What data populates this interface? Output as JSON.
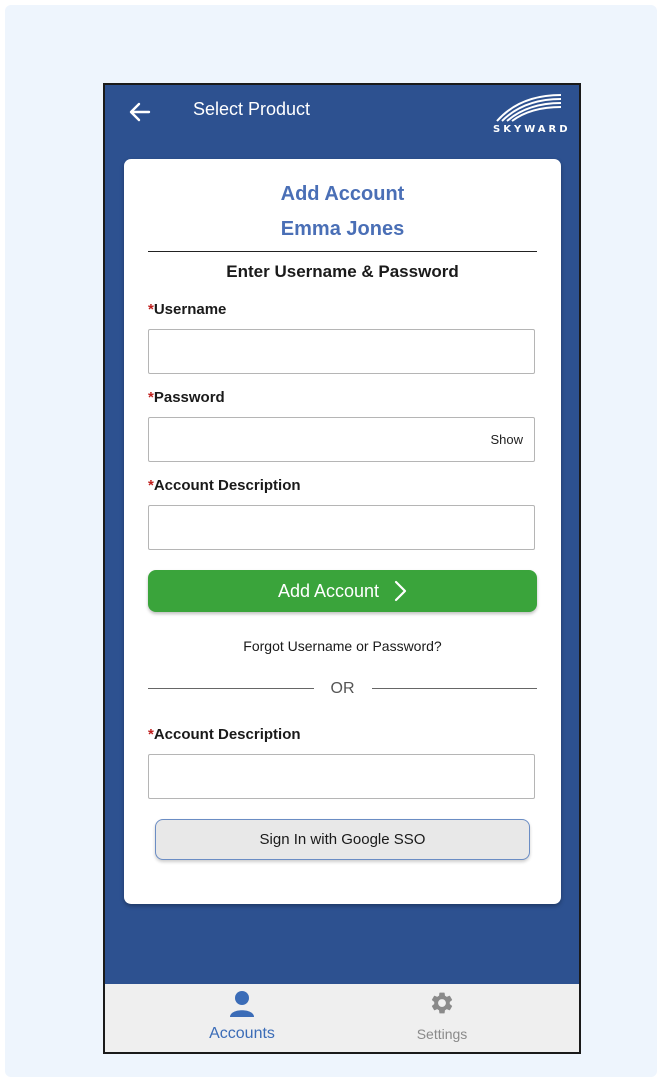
{
  "appbar": {
    "title": "Select Product",
    "back_icon": "arrow-left-icon",
    "logo_text": "SKYWARD"
  },
  "card": {
    "title": "Add Account",
    "subtitle": "Emma Jones",
    "section_heading": "Enter Username & Password",
    "required_marker": "*",
    "username_label": "Username",
    "password_label": "Password",
    "password_show": "Show",
    "description_label": "Account Description",
    "add_button_label": "Add Account",
    "forgot_link": "Forgot Username or Password?",
    "or_text": "OR",
    "sso_description_label": "Account Description",
    "sso_button_label": "Sign In with Google SSO"
  },
  "bottom_nav": {
    "items": [
      {
        "label": "Accounts",
        "icon": "person-icon",
        "active": true
      },
      {
        "label": "Settings",
        "icon": "gear-icon",
        "active": false
      }
    ]
  },
  "colors": {
    "header_bg": "#2d5190",
    "accent_text": "#4a6fb6",
    "primary_button": "#3aa43b",
    "required": "#c0201e",
    "nav_active": "#3b6cb7",
    "nav_inactive": "#8a8a8a"
  }
}
